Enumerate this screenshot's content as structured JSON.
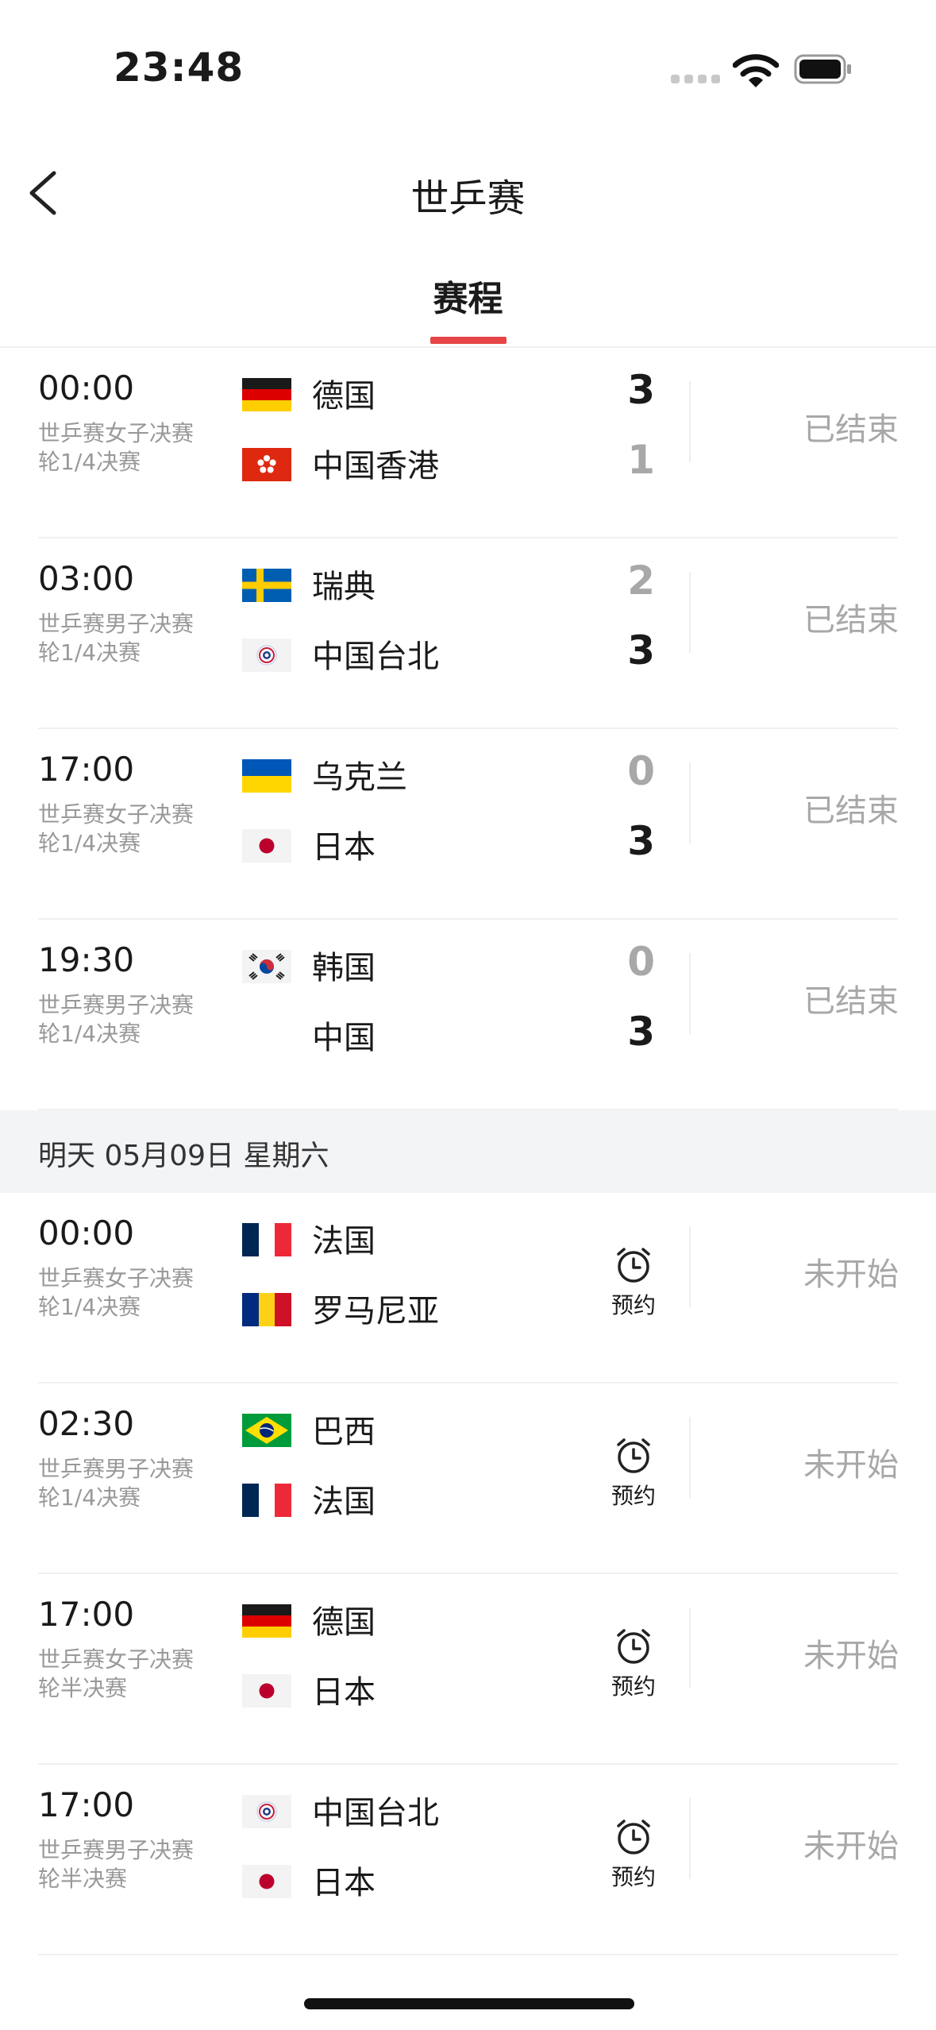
{
  "status_bar": {
    "time": "23:48"
  },
  "header": {
    "title": "世乒赛",
    "tab": "赛程"
  },
  "date_band": "明天 05月09日 星期六",
  "reserve_label": "预约",
  "matches_today": [
    {
      "time": "00:00",
      "desc": "世乒赛女子决赛轮1/4决赛",
      "team1": {
        "name": "德国",
        "flag": "germany-flag",
        "score": "3",
        "win": true
      },
      "team2": {
        "name": "中国香港",
        "flag": "hongkong-flag",
        "score": "1",
        "win": false
      },
      "status": "已结束"
    },
    {
      "time": "03:00",
      "desc": "世乒赛男子决赛轮1/4决赛",
      "team1": {
        "name": "瑞典",
        "flag": "sweden-flag",
        "score": "2",
        "win": false
      },
      "team2": {
        "name": "中国台北",
        "flag": "chinese-taipei-flag",
        "score": "3",
        "win": true
      },
      "status": "已结束"
    },
    {
      "time": "17:00",
      "desc": "世乒赛女子决赛轮1/4决赛",
      "team1": {
        "name": "乌克兰",
        "flag": "ukraine-flag",
        "score": "0",
        "win": false
      },
      "team2": {
        "name": "日本",
        "flag": "japan-flag",
        "score": "3",
        "win": true
      },
      "status": "已结束"
    },
    {
      "time": "19:30",
      "desc": "世乒赛男子决赛轮1/4决赛",
      "team1": {
        "name": "韩国",
        "flag": "korea-flag",
        "score": "0",
        "win": false
      },
      "team2": {
        "name": "中国",
        "flag": "",
        "score": "3",
        "win": true
      },
      "status": "已结束"
    }
  ],
  "matches_tomorrow": [
    {
      "time": "00:00",
      "desc": "世乒赛女子决赛轮1/4决赛",
      "team1": {
        "name": "法国",
        "flag": "france-flag"
      },
      "team2": {
        "name": "罗马尼亚",
        "flag": "romania-flag"
      },
      "status": "未开始"
    },
    {
      "time": "02:30",
      "desc": "世乒赛男子决赛轮1/4决赛",
      "team1": {
        "name": "巴西",
        "flag": "brazil-flag"
      },
      "team2": {
        "name": "法国",
        "flag": "france-flag"
      },
      "status": "未开始"
    },
    {
      "time": "17:00",
      "desc": "世乒赛女子决赛轮半决赛",
      "team1": {
        "name": "德国",
        "flag": "germany-flag"
      },
      "team2": {
        "name": "日本",
        "flag": "japan-flag"
      },
      "status": "未开始"
    },
    {
      "time": "17:00",
      "desc": "世乒赛男子决赛轮半决赛",
      "team1": {
        "name": "中国台北",
        "flag": "chinese-taipei-flag"
      },
      "team2": {
        "name": "日本",
        "flag": "japan-flag"
      },
      "status": "未开始"
    }
  ],
  "colors": {
    "accent": "#e64545",
    "muted": "#a8a8a8",
    "band": "#f3f4f6"
  }
}
